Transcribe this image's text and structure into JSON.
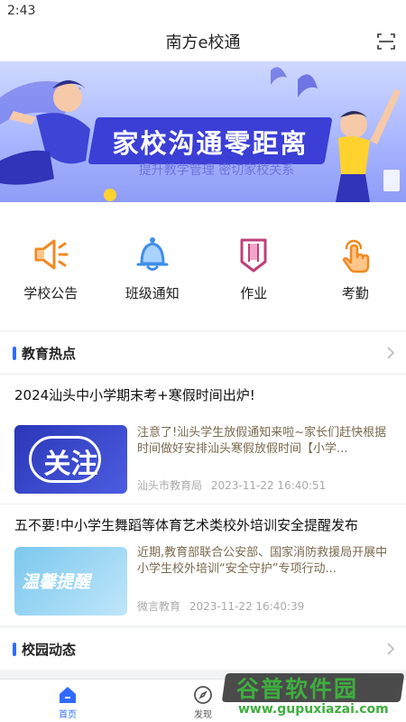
{
  "status": {
    "time": "2:43"
  },
  "header": {
    "title": "南方e校通",
    "scan_icon": "scan-icon"
  },
  "banner": {
    "title": "家校沟通零距离",
    "subtitle": "提升教学管理 密切家校关系"
  },
  "quick_actions": [
    {
      "label": "学校公告",
      "icon": "megaphone-icon",
      "color": "#f08a24"
    },
    {
      "label": "班级通知",
      "icon": "bell-icon",
      "color": "#3d8ee8"
    },
    {
      "label": "作业",
      "icon": "pencil-icon",
      "color": "#c0407a"
    },
    {
      "label": "考勤",
      "icon": "tap-hand-icon",
      "color": "#f08a24"
    }
  ],
  "sections": {
    "education": {
      "title": "教育热点"
    },
    "campus": {
      "title": "校园动态"
    }
  },
  "news": [
    {
      "headline": "2024汕头中小学期末考+寒假时间出炉!",
      "thumb_text": "关注",
      "summary": "注意了!汕头学生放假通知来啦~家长们赶快根据时间做好安排汕头寒假放假时间【小学...",
      "source": "汕头市教育局",
      "time": "2023-11-22 16:40:51"
    },
    {
      "headline": "五不要!中小学生舞蹈等体育艺术类校外培训安全提醒发布",
      "thumb_text": "温馨提醒",
      "summary": "近期,教育部联合公安部、国家消防救援局开展中小学生校外培训“安全守护”专项行动...",
      "source": "微言教育",
      "time": "2023-11-22 16:40:39"
    }
  ],
  "tabs": [
    {
      "label": "首页",
      "icon": "home-icon",
      "active": true
    },
    {
      "label": "发现",
      "icon": "compass-icon",
      "active": false
    }
  ],
  "watermark": {
    "title": "谷普软件园",
    "url": "www.gupuxiazai.com"
  },
  "colors": {
    "accent": "#2f6bff",
    "banner_title_bg": "#3b3fd6"
  }
}
